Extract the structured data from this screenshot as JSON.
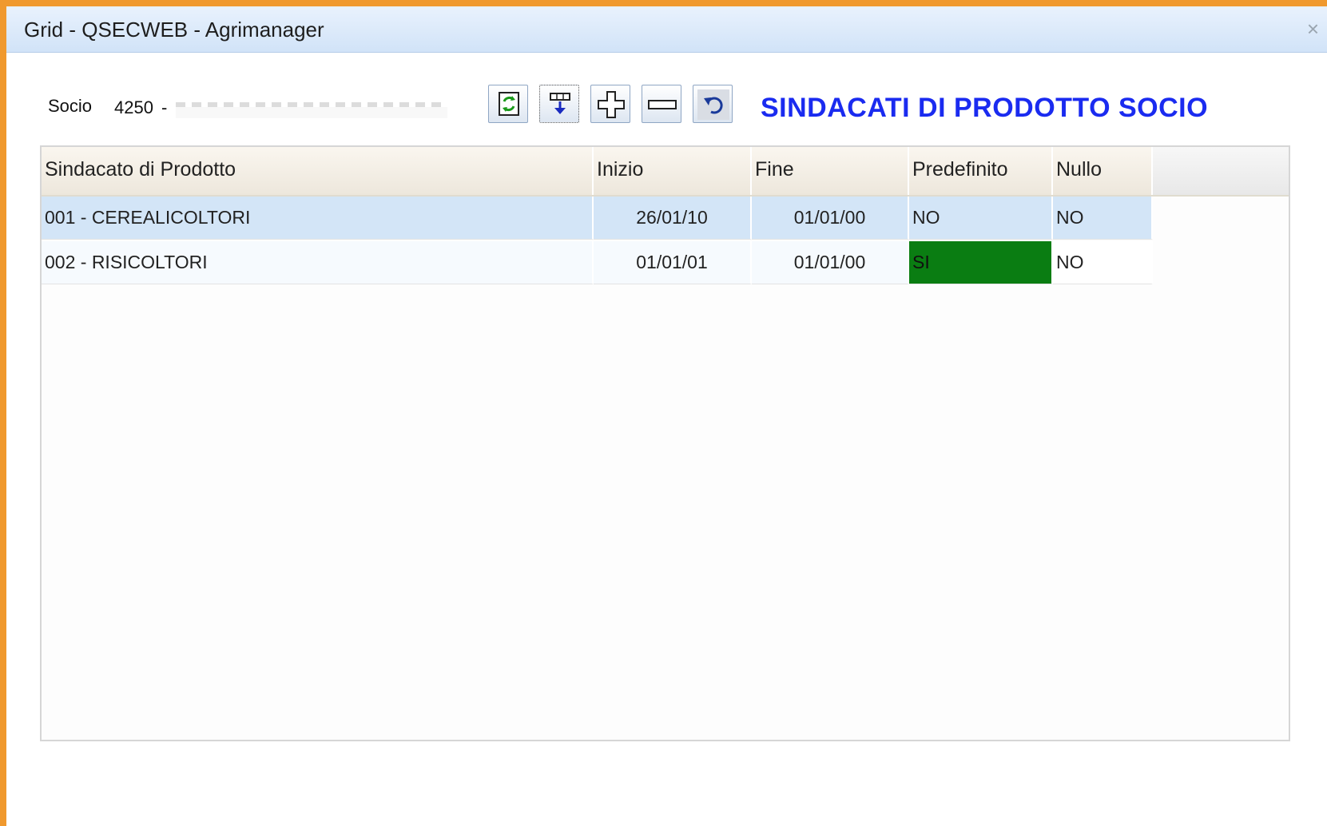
{
  "window": {
    "title": "Grid - QSECWEB - Agrimanager",
    "close_label": "×"
  },
  "header": {
    "socio_label": "Socio",
    "socio_code": "4250",
    "socio_separator": "-",
    "heading": "SINDACATI DI PRODOTTO SOCIO"
  },
  "toolbar": {
    "buttons": [
      {
        "icon": "refresh-icon"
      },
      {
        "icon": "filter-down-icon"
      },
      {
        "icon": "plus-icon"
      },
      {
        "icon": "minus-icon"
      },
      {
        "icon": "undo-icon"
      }
    ]
  },
  "grid": {
    "columns": [
      "Sindacato di Prodotto",
      "Inizio",
      "Fine",
      "Predefinito",
      "Nullo"
    ],
    "rows": [
      {
        "sindacato": "001 - CEREALICOLTORI",
        "inizio": "26/01/10",
        "fine": "01/01/00",
        "predefinito": "NO",
        "nullo": "NO",
        "selected": true
      },
      {
        "sindacato": "002 - RISICOLTORI",
        "inizio": "01/01/01",
        "fine": "01/01/00",
        "predefinito": "SI",
        "nullo": "NO",
        "selected": false
      }
    ]
  },
  "colors": {
    "window_border": "#f0992e",
    "heading": "#1a2bf0",
    "selected_row": "#d3e5f7",
    "predefinito_si": "#0a7d12"
  }
}
